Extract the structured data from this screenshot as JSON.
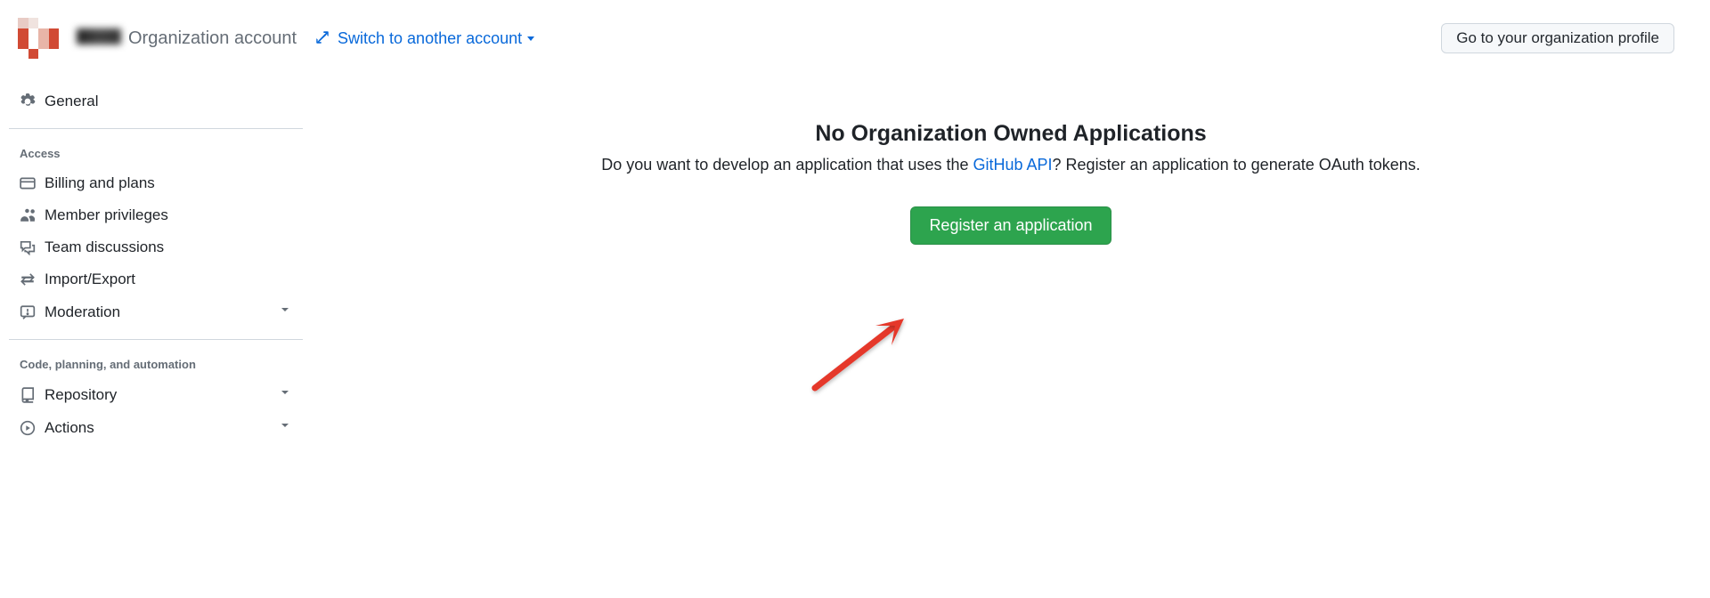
{
  "header": {
    "org_label": "Organization account",
    "switch_label": "Switch to another account",
    "profile_button": "Go to your organization profile"
  },
  "sidebar": {
    "general": "General",
    "sections": [
      {
        "heading": "Access",
        "items": [
          {
            "label": "Billing and plans",
            "icon": "credit-card-icon",
            "expandable": false
          },
          {
            "label": "Member privileges",
            "icon": "people-icon",
            "expandable": false
          },
          {
            "label": "Team discussions",
            "icon": "comment-discussion-icon",
            "expandable": false
          },
          {
            "label": "Import/Export",
            "icon": "arrow-switch-icon",
            "expandable": false
          },
          {
            "label": "Moderation",
            "icon": "report-icon",
            "expandable": true
          }
        ]
      },
      {
        "heading": "Code, planning, and automation",
        "items": [
          {
            "label": "Repository",
            "icon": "repo-icon",
            "expandable": true
          },
          {
            "label": "Actions",
            "icon": "play-icon",
            "expandable": true
          }
        ]
      }
    ]
  },
  "main": {
    "title": "No Organization Owned Applications",
    "text_before": "Do you want to develop an application that uses the ",
    "api_link": "GitHub API",
    "text_after": "? Register an application to generate OAuth tokens.",
    "register_button": "Register an application"
  }
}
